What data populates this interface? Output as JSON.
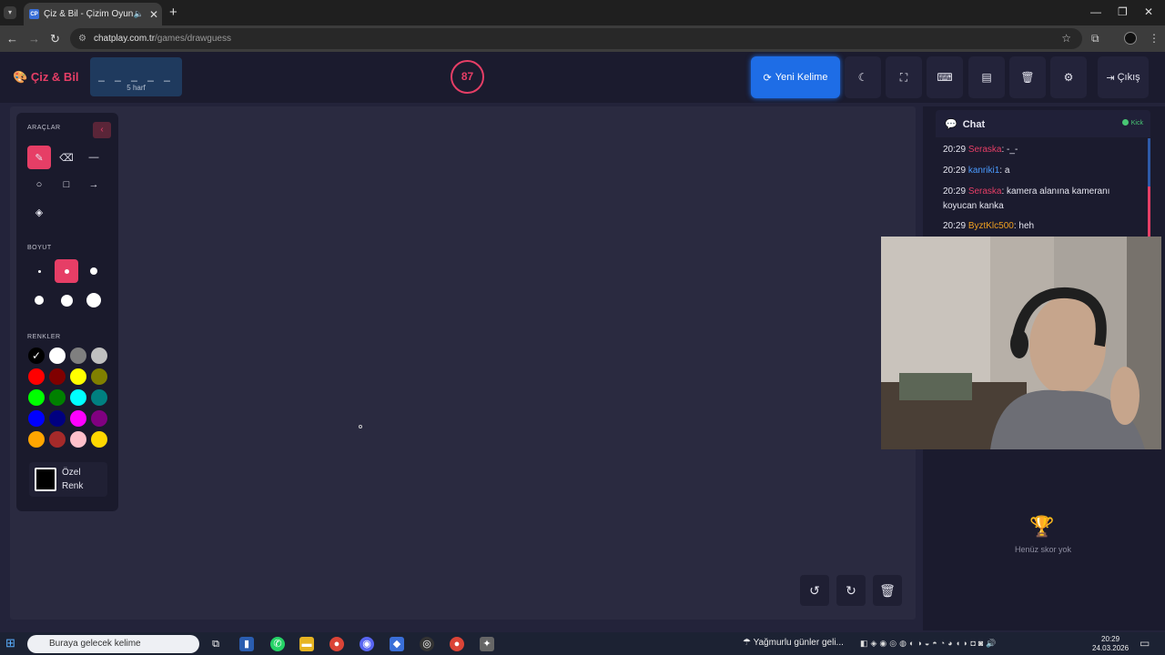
{
  "browser": {
    "tab_title": "Çiz & Bil - Çizim Oyunu",
    "tab_favicon": "CP",
    "url_host": "chatplay.com.tr",
    "url_path": "/games/drawguess"
  },
  "header": {
    "logo": "Çiz & Bil",
    "word_mask": "_ _ _ _ _",
    "word_hint": "5 harf",
    "timer": "87",
    "new_word_label": "Yeni Kelime",
    "exit_label": "Çıkış"
  },
  "tools": {
    "tools_title": "ARAÇLAR",
    "size_title": "BOYUT",
    "colors_title": "RENKLER",
    "custom_color_label_1": "Özel",
    "custom_color_label_2": "Renk",
    "palette": [
      "#000000",
      "#ffffff",
      "#7f7f7f",
      "#c0c0c0",
      "#ff0000",
      "#800000",
      "#ffff00",
      "#808000",
      "#00ff00",
      "#008000",
      "#00ffff",
      "#008080",
      "#0000ff",
      "#000080",
      "#ff00ff",
      "#800080",
      "#ffa500",
      "#a52a2a",
      "#ffc0cb",
      "#ffd700"
    ],
    "accent_color": "#e63e66"
  },
  "chat": {
    "title": "Chat",
    "kick_label": "Kick",
    "messages": [
      {
        "time": "20:29",
        "user": "Seraska",
        "user_color": "#e63e66",
        "text": ": -_-"
      },
      {
        "time": "20:29",
        "user": "kanriki1",
        "user_color": "#4a9bff",
        "text": ": a"
      },
      {
        "time": "20:29",
        "user": "Seraska",
        "user_color": "#e63e66",
        "text": ": kamera alanına kameranı koyucan kanka"
      },
      {
        "time": "20:29",
        "user": "ByztKlc500",
        "user_color": "#f0a020",
        "text": ": heh"
      }
    ]
  },
  "scoreboard": {
    "empty_text": "Henüz skor yok"
  },
  "taskbar": {
    "search_text": "Buraya gelecek kelime",
    "weather": "Yağmurlu günler geli...",
    "time": "20:29",
    "date": "24.03.2026"
  }
}
